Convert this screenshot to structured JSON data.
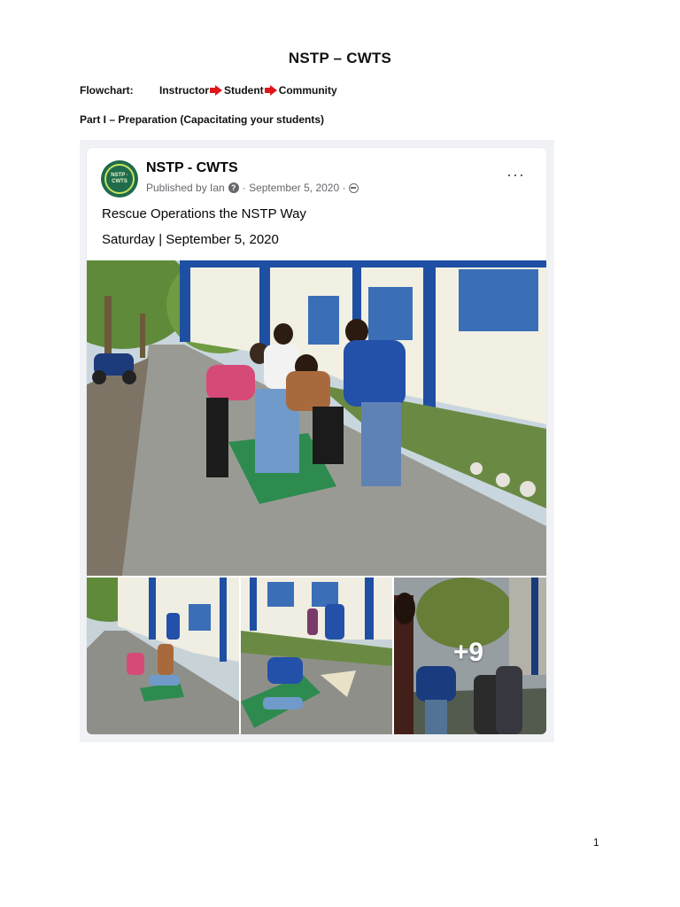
{
  "document": {
    "title": "NSTP – CWTS",
    "flowchart_label": "Flowchart:",
    "flow_steps": [
      "Instructor",
      "Student",
      "Community"
    ],
    "part_heading": "Part I – Preparation (Capacitating your students)",
    "page_number": "1"
  },
  "post": {
    "avatar_text": "NSTP · CWTS",
    "page_name": "NSTP - CWTS",
    "published_by": "Published by Ian",
    "date": "· September 5, 2020 ·",
    "more_icon": "···",
    "text_line1": "Rescue Operations the NSTP Way",
    "text_line2": "Saturday | September 5, 2020",
    "more_photos": "+9"
  },
  "colors": {
    "arrow": "#e0141b",
    "avatar_bg": "#1f6b4c",
    "meta_text": "#65676b",
    "card_bg": "#f0f2f5"
  }
}
